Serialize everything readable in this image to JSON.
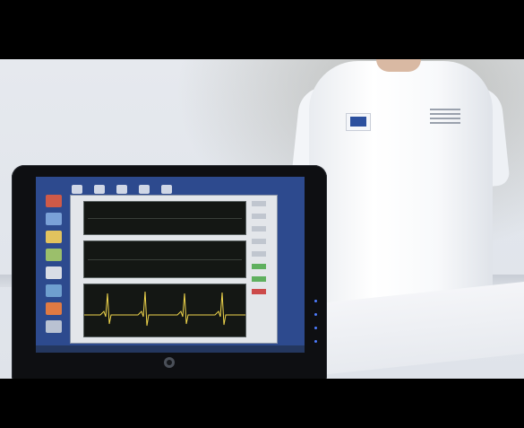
{
  "scene": {
    "description_tags": [
      "letterbox-video-frame",
      "laptop",
      "person",
      "ecg-waveforms"
    ]
  },
  "colors": {
    "wall": "#e3e7ed",
    "shirt": "#ffffff",
    "laptop_bezel": "#0e0f12",
    "desktop_bg": "#2d4a8e",
    "plot_bg": "#141714",
    "trace": "#f0d64c"
  }
}
